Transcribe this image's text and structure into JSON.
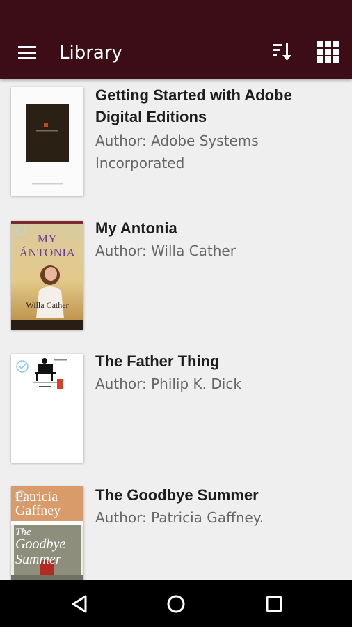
{
  "app_bar": {
    "title": "Library",
    "menu_icon": "hamburger-menu-icon",
    "sort_icon": "sort-icon",
    "grid_icon": "grid-view-icon"
  },
  "books": [
    {
      "title": "Getting Started with Adobe Digital Editions",
      "author": "Author: Adobe Systems Incorporated",
      "cover": "adobe-guide-cover"
    },
    {
      "title": "My Antonia",
      "author": "Author: Willa Cather",
      "cover_title": "MY ÁNTONIA",
      "cover_author": "Willa Cather",
      "cover": "my-antonia-cover"
    },
    {
      "title": "The Father Thing",
      "author": "Author: Philip K. Dick",
      "cover": "father-thing-cover"
    },
    {
      "title": "The Goodbye Summer",
      "author": "Author: Patricia Gaffney.",
      "cover_author_line1": "Patricia",
      "cover_author_line2": "Gaffney",
      "cover_title_line1": "The",
      "cover_title_line2": "Goodbye",
      "cover_title_line3": "Summer",
      "cover": "goodbye-summer-cover"
    }
  ],
  "nav_bar": {
    "back_icon": "back-icon",
    "home_icon": "home-icon",
    "recents_icon": "recents-icon"
  },
  "colors": {
    "app_bar": "#3d0d17",
    "background": "#efefef",
    "nav_bar": "#000000"
  }
}
